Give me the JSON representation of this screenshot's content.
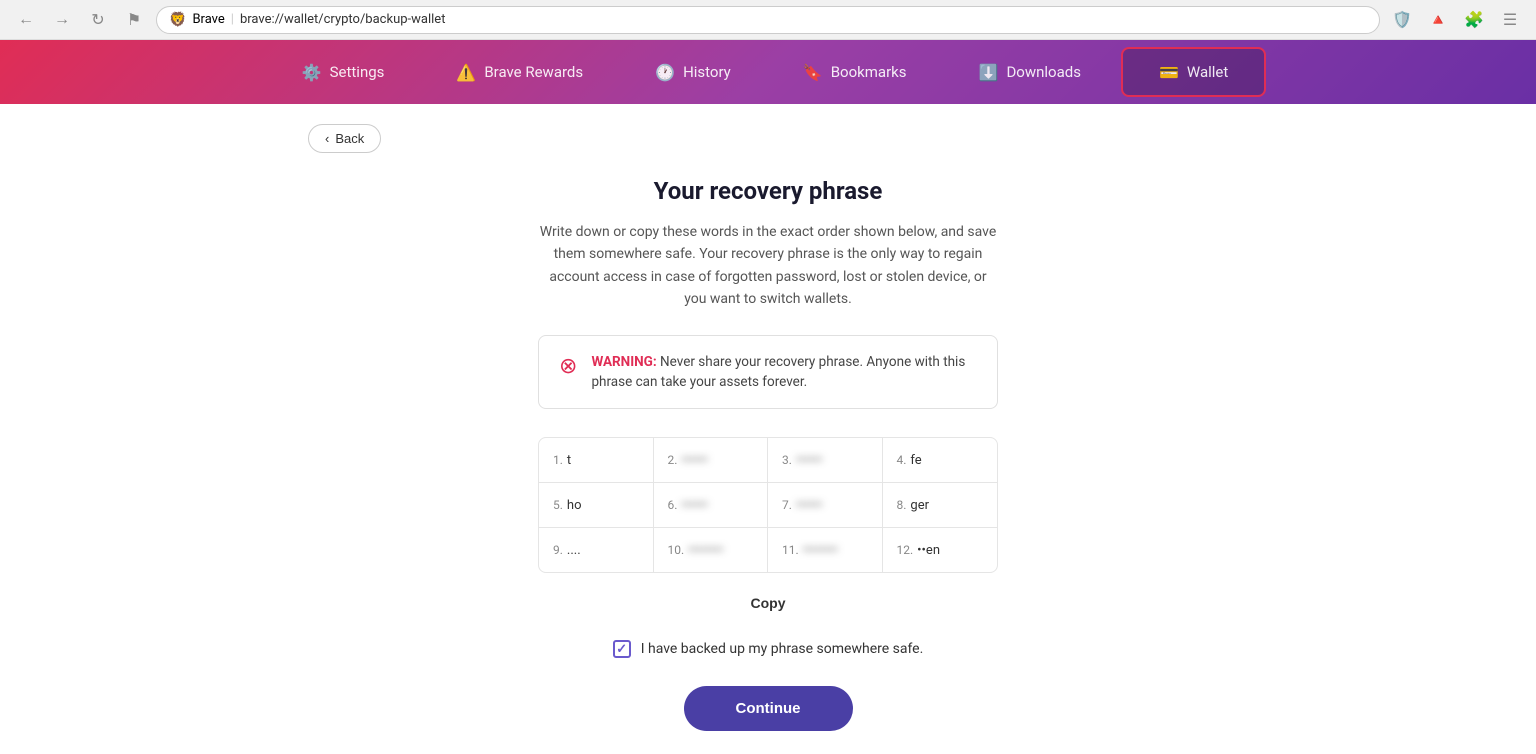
{
  "browser": {
    "url": "brave://wallet/crypto/backup-wallet",
    "shield_icon": "🦁",
    "title": "Brave"
  },
  "navbar": {
    "items": [
      {
        "id": "settings",
        "label": "Settings",
        "icon": "⚙️",
        "active": false
      },
      {
        "id": "brave-rewards",
        "label": "Brave Rewards",
        "icon": "⚠️",
        "active": false
      },
      {
        "id": "history",
        "label": "History",
        "icon": "🕐",
        "active": false
      },
      {
        "id": "bookmarks",
        "label": "Bookmarks",
        "icon": "🔖",
        "active": false
      },
      {
        "id": "downloads",
        "label": "Downloads",
        "icon": "⬇️",
        "active": false
      },
      {
        "id": "wallet",
        "label": "Wallet",
        "icon": "💳",
        "active": true
      }
    ]
  },
  "back_button": "Back",
  "page": {
    "title": "Your recovery phrase",
    "subtitle": "Write down or copy these words in the exact order shown below, and save them somewhere safe. Your recovery phrase is the only way to regain account access in case of forgotten password, lost or stolen device, or you want to switch wallets.",
    "warning": {
      "text_bold": "WARNING:",
      "text": " Never share your recovery phrase. Anyone with this phrase can take your assets forever."
    },
    "phrase_rows": [
      [
        {
          "num": "1.",
          "word": "t",
          "blur": false
        },
        {
          "num": "2.",
          "word": "••••••",
          "blur": true
        },
        {
          "num": "3.",
          "word": "••••••",
          "blur": true
        },
        {
          "num": "4.",
          "word": "fe",
          "blur": false
        }
      ],
      [
        {
          "num": "5.",
          "word": "ho",
          "blur": false
        },
        {
          "num": "6.",
          "word": "••••••",
          "blur": true
        },
        {
          "num": "7.",
          "word": "••••••",
          "blur": true
        },
        {
          "num": "8.",
          "word": "ger",
          "blur": false
        }
      ],
      [
        {
          "num": "9.",
          "word": "....",
          "blur": false
        },
        {
          "num": "10.",
          "word": "••••••••",
          "blur": true
        },
        {
          "num": "11.",
          "word": "••••••••",
          "blur": true
        },
        {
          "num": "12.",
          "word": "••en",
          "blur": false
        }
      ]
    ],
    "copy_label": "Copy",
    "checkbox_label": "I have backed up my phrase somewhere safe.",
    "checkbox_checked": true,
    "continue_label": "Continue"
  }
}
